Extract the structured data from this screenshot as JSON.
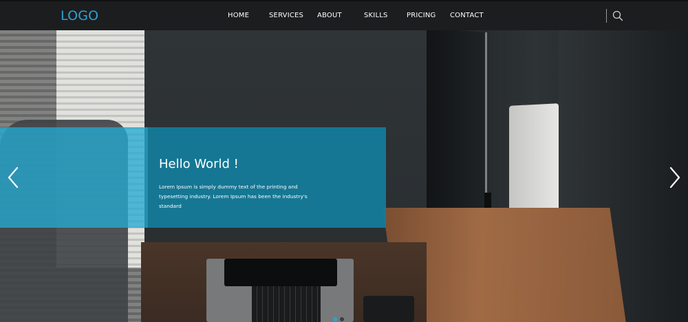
{
  "header": {
    "logo": "LOGO",
    "nav": [
      {
        "label": "HOME"
      },
      {
        "label": "SERVICES"
      },
      {
        "label": "ABOUT"
      },
      {
        "label": "SKILLS"
      },
      {
        "label": "PRICING"
      },
      {
        "label": "CONTACT"
      }
    ],
    "search_icon": "search-icon"
  },
  "hero": {
    "title": "Hello World !",
    "text": "Lorem Ipsum is simply dummy text of the printing and typesetting industry. Lorem Ipsum has been the industry's standard",
    "prev_icon": "chevron-left-icon",
    "next_icon": "chevron-right-icon",
    "slide_count": 2,
    "active_slide": 1
  },
  "colors": {
    "accent": "#28a3d6",
    "overlay": "#137d9c",
    "navbar_bg": "#1c1d1f"
  }
}
